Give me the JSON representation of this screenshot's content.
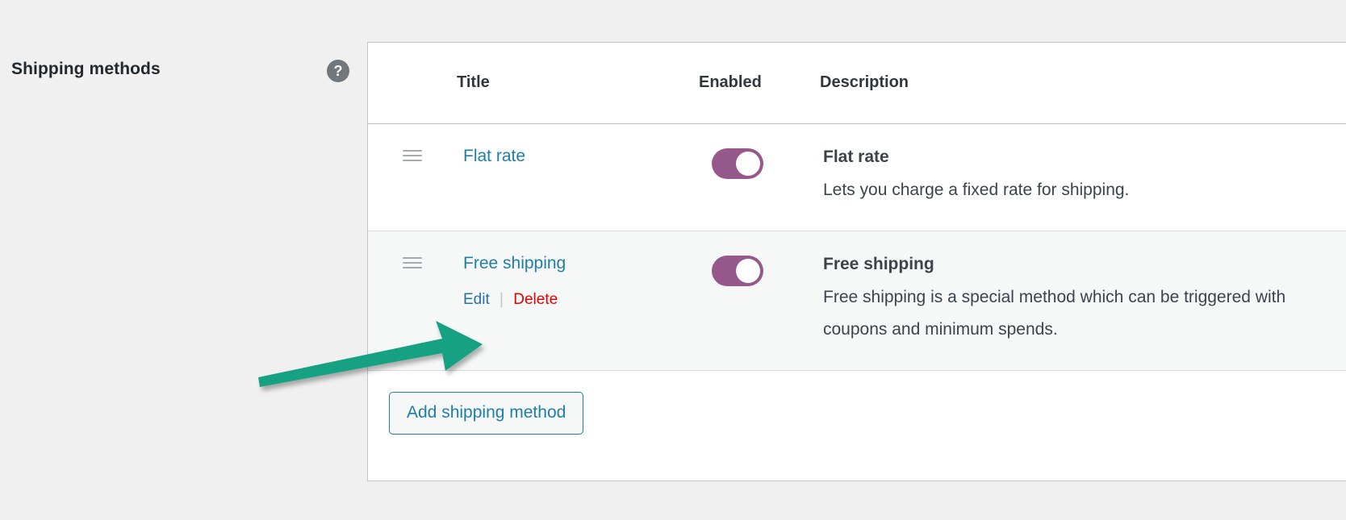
{
  "section": {
    "label": "Shipping methods",
    "help_icon": "question-mark-circle-icon",
    "help_glyph": "?"
  },
  "table": {
    "columns": [
      "",
      "Title",
      "Enabled",
      "Description"
    ],
    "rows": [
      {
        "sort_handle_icon": "drag-handle-icon",
        "title": "Flat rate",
        "enabled": true,
        "enabled_label": "Enabled",
        "desc_title": "Flat rate",
        "desc_text": "Lets you charge a fixed rate for shipping.",
        "actions": []
      },
      {
        "sort_handle_icon": "drag-handle-icon",
        "title": "Free shipping",
        "enabled": true,
        "enabled_label": "Enabled",
        "desc_title": "Free shipping",
        "desc_text": "Free shipping is a special method which can be triggered with coupons and minimum spends.",
        "actions": [
          {
            "label": "Edit",
            "kind": "edit"
          },
          {
            "separator": "|"
          },
          {
            "label": "Delete",
            "kind": "delete"
          }
        ]
      }
    ]
  },
  "footer": {
    "add_button_label": "Add shipping method"
  },
  "annotation": {
    "type": "arrow",
    "color": "#12a183",
    "points_to": "Edit"
  },
  "colors": {
    "page_background": "#f0f0f1",
    "panel_background": "#ffffff",
    "alt_row_background": "#f6f7f7",
    "border": "#c3c4c7",
    "link": "#1d7ea8",
    "edit_link": "#2271b1",
    "delete_link": "#e40000",
    "toggle_on": "#96588a",
    "toggle_knob": "#ffffff",
    "help_icon": "#72777c",
    "heading_text": "#23282d",
    "body_text": "#3c434a",
    "annotation_arrow": "#12a183"
  }
}
